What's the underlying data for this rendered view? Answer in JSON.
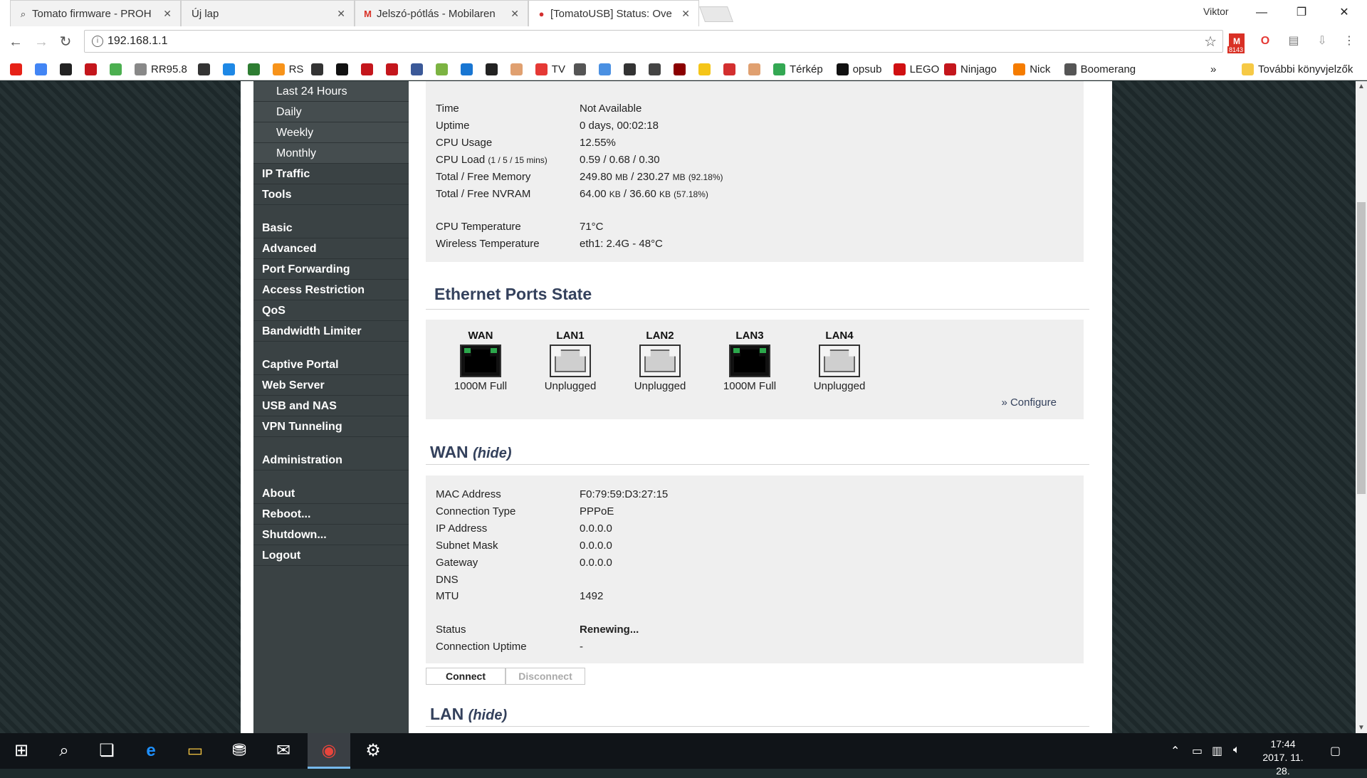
{
  "browser": {
    "tabs": [
      {
        "title": "Tomato firmware - PROH",
        "icon": "search-favicon"
      },
      {
        "title": "Új lap",
        "icon": ""
      },
      {
        "title": "Jelszó-pótlás - Mobilaren",
        "icon": "gmail-favicon"
      },
      {
        "title": "[TomatoUSB] Status: Ove",
        "icon": "tomato-favicon"
      }
    ],
    "user": "Viktor",
    "url": "192.168.1.1",
    "gmail_count": "8143",
    "bookmarks": [
      {
        "label": "",
        "color": "#e62117"
      },
      {
        "label": "",
        "color": "#4285f4"
      },
      {
        "label": "",
        "color": "#222222"
      },
      {
        "label": "",
        "color": "#c4161c"
      },
      {
        "label": "",
        "color": "#4caf50"
      },
      {
        "label": "RR95.8",
        "color": "#888888"
      },
      {
        "label": "",
        "color": "#333333"
      },
      {
        "label": "",
        "color": "#1e88e5"
      },
      {
        "label": "",
        "color": "#2e7d32"
      },
      {
        "label": "RS",
        "color": "#f7931a"
      },
      {
        "label": "",
        "color": "#333333"
      },
      {
        "label": "",
        "color": "#111111"
      },
      {
        "label": "",
        "color": "#c4161c"
      },
      {
        "label": "",
        "color": "#c4161c"
      },
      {
        "label": "",
        "color": "#3b5998"
      },
      {
        "label": "",
        "color": "#7cb342"
      },
      {
        "label": "",
        "color": "#1976d2"
      },
      {
        "label": "",
        "color": "#222222"
      },
      {
        "label": "",
        "color": "#e0a070"
      },
      {
        "label": "TV",
        "color": "#e53935"
      },
      {
        "label": "",
        "color": "#555555"
      },
      {
        "label": "",
        "color": "#4a90e2"
      },
      {
        "label": "",
        "color": "#333333"
      },
      {
        "label": "",
        "color": "#444444"
      },
      {
        "label": "",
        "color": "#8b0000"
      },
      {
        "label": "",
        "color": "#f5c518"
      },
      {
        "label": "",
        "color": "#d32f2f"
      },
      {
        "label": "",
        "color": "#e0a070"
      },
      {
        "label": "Térkép",
        "color": "#34a853"
      },
      {
        "label": "opsub",
        "color": "#111111"
      },
      {
        "label": "LEGO",
        "color": "#d01012"
      },
      {
        "label": "Ninjago",
        "color": "#c4161c"
      },
      {
        "label": "Nick",
        "color": "#f57c00"
      },
      {
        "label": "Boomerang",
        "color": "#555555"
      }
    ],
    "more_bookmarks": "»",
    "other_bookmarks": "További könyvjelzők"
  },
  "sidebar": {
    "subitems": [
      "Last 24 Hours",
      "Daily",
      "Weekly",
      "Monthly"
    ],
    "group1": [
      "IP Traffic",
      "Tools"
    ],
    "group2": [
      "Basic",
      "Advanced",
      "Port Forwarding",
      "Access Restriction",
      "QoS",
      "Bandwidth Limiter"
    ],
    "group3": [
      "Captive Portal",
      "Web Server",
      "USB and NAS",
      "VPN Tunneling"
    ],
    "group4": [
      "Administration"
    ],
    "group5": [
      "About",
      "Reboot...",
      "Shutdown...",
      "Logout"
    ]
  },
  "system": {
    "time_label": "Time",
    "time": "Not Available",
    "uptime_label": "Uptime",
    "uptime": "0 days, 00:02:18",
    "cpu_usage_label": "CPU Usage",
    "cpu_usage": "12.55%",
    "cpu_load_label": "CPU Load",
    "cpu_load_unit": "(1 / 5 / 15 mins)",
    "cpu_load": "0.59 / 0.68 / 0.30",
    "memory_label": "Total / Free Memory",
    "memory_total": "249.80",
    "memory_free": "230.27",
    "memory_unit": "MB",
    "memory_pct": "(92.18%)",
    "nvram_label": "Total / Free NVRAM",
    "nvram_total": "64.00",
    "nvram_free": "36.60",
    "nvram_unit": "KB",
    "nvram_pct": "(57.18%)",
    "cpu_temp_label": "CPU Temperature",
    "cpu_temp": "71°C",
    "wifi_temp_label": "Wireless Temperature",
    "wifi_temp": "eth1: 2.4G - 48°C"
  },
  "ethernet": {
    "title": "Ethernet Ports State",
    "ports": [
      {
        "name": "WAN",
        "state": "1000M Full",
        "connected": true
      },
      {
        "name": "LAN1",
        "state": "Unplugged",
        "connected": false
      },
      {
        "name": "LAN2",
        "state": "Unplugged",
        "connected": false
      },
      {
        "name": "LAN3",
        "state": "1000M Full",
        "connected": true
      },
      {
        "name": "LAN4",
        "state": "Unplugged",
        "connected": false
      }
    ],
    "configure": "» Configure"
  },
  "wan": {
    "title": "WAN",
    "hide": "(hide)",
    "mac_label": "MAC Address",
    "mac": "F0:79:59:D3:27:15",
    "conn_type_label": "Connection Type",
    "conn_type": "PPPoE",
    "ip_label": "IP Address",
    "ip": "0.0.0.0",
    "subnet_label": "Subnet Mask",
    "subnet": "0.0.0.0",
    "gateway_label": "Gateway",
    "gateway": "0.0.0.0",
    "dns_label": "DNS",
    "dns": "",
    "mtu_label": "MTU",
    "mtu": "1492",
    "status_label": "Status",
    "status": "Renewing...",
    "conn_uptime_label": "Connection Uptime",
    "conn_uptime": "-",
    "connect": "Connect",
    "disconnect": "Disconnect"
  },
  "lan": {
    "title": "LAN",
    "hide": "(hide)"
  },
  "taskbar": {
    "time": "17:44",
    "date": "2017. 11. 28."
  }
}
